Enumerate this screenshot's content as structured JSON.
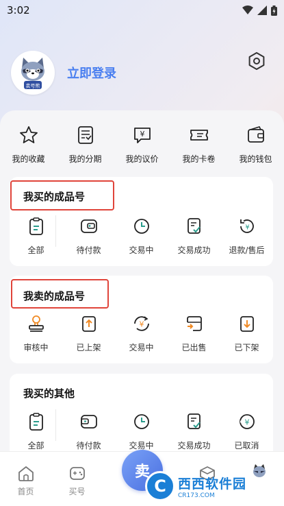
{
  "status_bar": {
    "time": "3:02"
  },
  "profile": {
    "login_label": "立即登录",
    "avatar_badge": "卖号熊"
  },
  "quick_actions": [
    {
      "label": "我的收藏",
      "icon": "star-icon"
    },
    {
      "label": "我的分期",
      "icon": "installment-icon"
    },
    {
      "label": "我的议价",
      "icon": "bargain-icon"
    },
    {
      "label": "我的卡卷",
      "icon": "coupon-icon"
    },
    {
      "label": "我的钱包",
      "icon": "wallet-icon"
    }
  ],
  "buy_section": {
    "title": "我买的成品号",
    "items": [
      {
        "label": "全部",
        "icon": "clipboard-icon"
      },
      {
        "label": "待付款",
        "icon": "wallet-icon"
      },
      {
        "label": "交易中",
        "icon": "clock-icon"
      },
      {
        "label": "交易成功",
        "icon": "check-doc-icon"
      },
      {
        "label": "退款/售后",
        "icon": "refund-icon"
      }
    ]
  },
  "sell_section": {
    "title": "我卖的成品号",
    "items": [
      {
        "label": "审核中",
        "icon": "stamp-icon"
      },
      {
        "label": "已上架",
        "icon": "upload-icon"
      },
      {
        "label": "交易中",
        "icon": "yuan-cycle-icon"
      },
      {
        "label": "已出售",
        "icon": "sold-icon"
      },
      {
        "label": "已下架",
        "icon": "download-icon"
      }
    ]
  },
  "other_section": {
    "title": "我买的其他",
    "items": [
      {
        "label": "全部",
        "icon": "clipboard-icon"
      },
      {
        "label": "待付款",
        "icon": "wallet-icon"
      },
      {
        "label": "交易中",
        "icon": "clock-icon"
      },
      {
        "label": "交易成功",
        "icon": "check-doc-icon"
      },
      {
        "label": "已取消",
        "icon": "yuan-cancel-icon"
      }
    ]
  },
  "tab_bar": [
    {
      "label": "首页",
      "icon": "home-icon"
    },
    {
      "label": "买号",
      "icon": "gamepad-icon"
    },
    {
      "label": "",
      "icon": "sell-icon"
    },
    {
      "label": "",
      "icon": "box-icon"
    },
    {
      "label": "",
      "icon": "mascot-icon"
    }
  ],
  "center_button": {
    "label": "卖"
  },
  "watermark": {
    "mark": "C",
    "name": "西西软件园",
    "domain": "CR173.COM"
  },
  "colors": {
    "accent": "#4a7ff0",
    "highlight": "#e0443a",
    "icon_teal": "#2a9c8c",
    "icon_orange": "#f08a24"
  }
}
